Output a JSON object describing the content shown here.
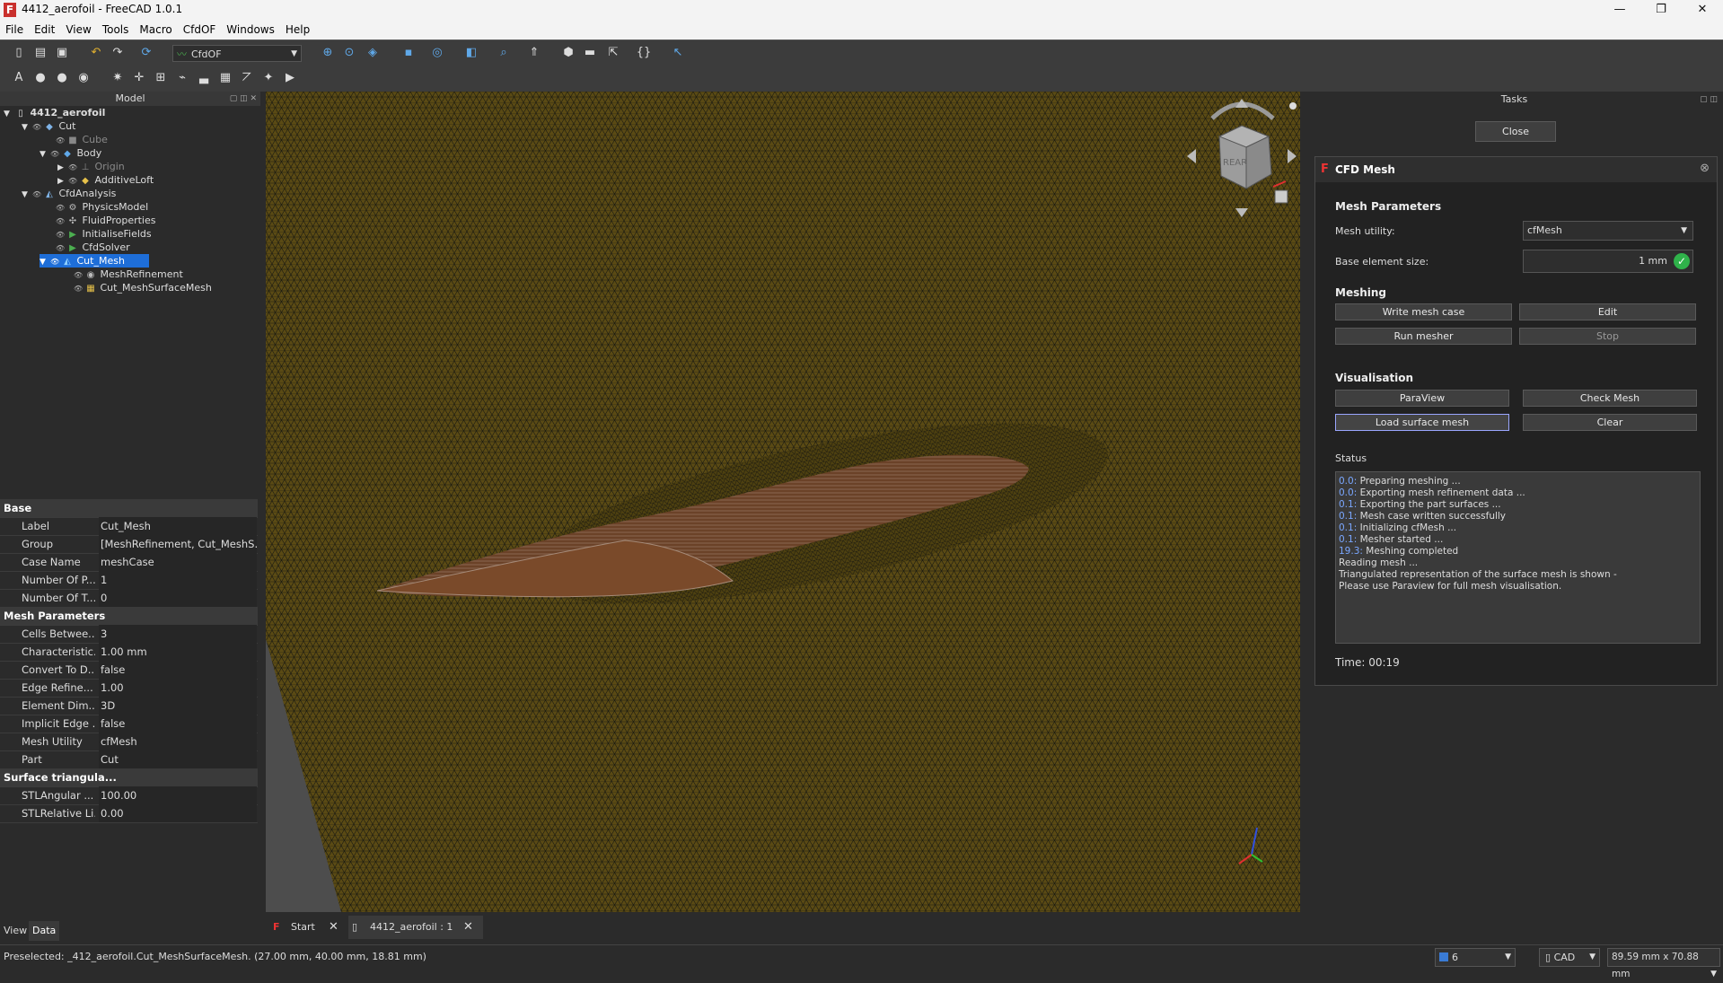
{
  "window": {
    "title": "4412_aerofoil - FreeCAD 1.0.1",
    "app_icon": "F",
    "minimize": "—",
    "maximize": "❐",
    "close": "✕"
  },
  "menu": [
    "File",
    "Edit",
    "View",
    "Tools",
    "Macro",
    "CfdOF",
    "Windows",
    "Help"
  ],
  "toolbar": {
    "workbench": "CfdOF"
  },
  "model_panel": {
    "title": "Model",
    "tree": [
      {
        "label": "4412_aerofoil",
        "icon": "document-icon"
      },
      {
        "label": "Cut",
        "icon": "cut-icon"
      },
      {
        "label": "Cube",
        "icon": "cube-icon"
      },
      {
        "label": "Body",
        "icon": "body-icon"
      },
      {
        "label": "Origin",
        "icon": "origin-icon"
      },
      {
        "label": "AdditiveLoft",
        "icon": "loft-icon"
      },
      {
        "label": "CfdAnalysis",
        "icon": "analysis-icon"
      },
      {
        "label": "PhysicsModel",
        "icon": "physics-icon"
      },
      {
        "label": "FluidProperties",
        "icon": "fluid-icon"
      },
      {
        "label": "InitialiseFields",
        "icon": "initialise-icon"
      },
      {
        "label": "CfdSolver",
        "icon": "solver-icon"
      },
      {
        "label": "Cut_Mesh",
        "icon": "mesh-icon"
      },
      {
        "label": "MeshRefinement",
        "icon": "refinement-icon"
      },
      {
        "label": "Cut_MeshSurfaceMesh",
        "icon": "surface-mesh-icon"
      }
    ]
  },
  "properties": {
    "groups": [
      {
        "name": "Base",
        "rows": [
          {
            "key": "Label",
            "value": "Cut_Mesh"
          },
          {
            "key": "Group",
            "value": "[MeshRefinement, Cut_MeshS..."
          },
          {
            "key": "Case Name",
            "value": "meshCase"
          },
          {
            "key": "Number Of P...",
            "value": "1"
          },
          {
            "key": "Number Of T...",
            "value": "0"
          }
        ]
      },
      {
        "name": "Mesh Parameters",
        "rows": [
          {
            "key": "Cells Betwee...",
            "value": "3"
          },
          {
            "key": "Characteristic...",
            "value": "1.00 mm"
          },
          {
            "key": "Convert To D...",
            "value": "false"
          },
          {
            "key": "Edge Refine...",
            "value": "1.00"
          },
          {
            "key": "Element Dim...",
            "value": "3D"
          },
          {
            "key": "Implicit Edge ...",
            "value": "false"
          },
          {
            "key": "Mesh Utility",
            "value": "cfMesh"
          },
          {
            "key": "Part",
            "value": "Cut"
          }
        ]
      },
      {
        "name": "Surface triangula...",
        "rows": [
          {
            "key": "STLAngular ...",
            "value": "100.00"
          },
          {
            "key": "STLRelative Li...",
            "value": "0.00"
          }
        ]
      }
    ],
    "tabs": [
      "View",
      "Data"
    ]
  },
  "navcube": {
    "face": "REAR"
  },
  "doc_tabs": [
    {
      "label": "Start"
    },
    {
      "label": "4412_aerofoil : 1"
    }
  ],
  "tasks": {
    "title": "Tasks",
    "close_label": "Close",
    "cfd_title": "CFD Mesh",
    "mesh_parameters": {
      "heading": "Mesh Parameters",
      "utility_label": "Mesh utility:",
      "utility_value": "cfMesh",
      "size_label": "Base element size:",
      "size_value": "1 mm"
    },
    "meshing": {
      "heading": "Meshing",
      "write": "Write mesh case",
      "edit": "Edit",
      "run": "Run mesher",
      "stop": "Stop"
    },
    "visualisation": {
      "heading": "Visualisation",
      "paraview": "ParaView",
      "check": "Check Mesh",
      "load": "Load surface mesh",
      "clear": "Clear"
    },
    "status": {
      "heading": "Status",
      "lines": [
        {
          "time": "0.0:",
          "text": " Preparing meshing ..."
        },
        {
          "time": "0.0:",
          "text": " Exporting mesh refinement data ..."
        },
        {
          "time": "0.1:",
          "text": " Exporting the part surfaces ..."
        },
        {
          "time": "0.1:",
          "text": " Mesh case written successfully"
        },
        {
          "time": "0.1:",
          "text": " Initializing cfMesh ..."
        },
        {
          "time": "0.1:",
          "text": " Mesher started ..."
        },
        {
          "time": "19.3:",
          "text": " Meshing completed"
        },
        {
          "time": "",
          "text": "Reading mesh ..."
        },
        {
          "time": "",
          "text": "Triangulated representation of the surface mesh is shown -"
        },
        {
          "time": "",
          "text": "Please use Paraview for full mesh visualisation."
        }
      ]
    },
    "time": "Time: 00:19"
  },
  "statusbar": {
    "message": "Preselected: _412_aerofoil.Cut_MeshSurfaceMesh. (27.00 mm, 40.00 mm, 18.81 mm)",
    "page_value": "6",
    "nav_style": "CAD",
    "dimensions": "89.59 mm x 70.88 mm"
  },
  "colors": {
    "mesh_bg": "#5a4a14",
    "mesh_line": "#1a1a1a",
    "aerofoil": "#7a4a2a",
    "selection": "#1e6ed8",
    "accent_link": "#7aa7ff"
  }
}
